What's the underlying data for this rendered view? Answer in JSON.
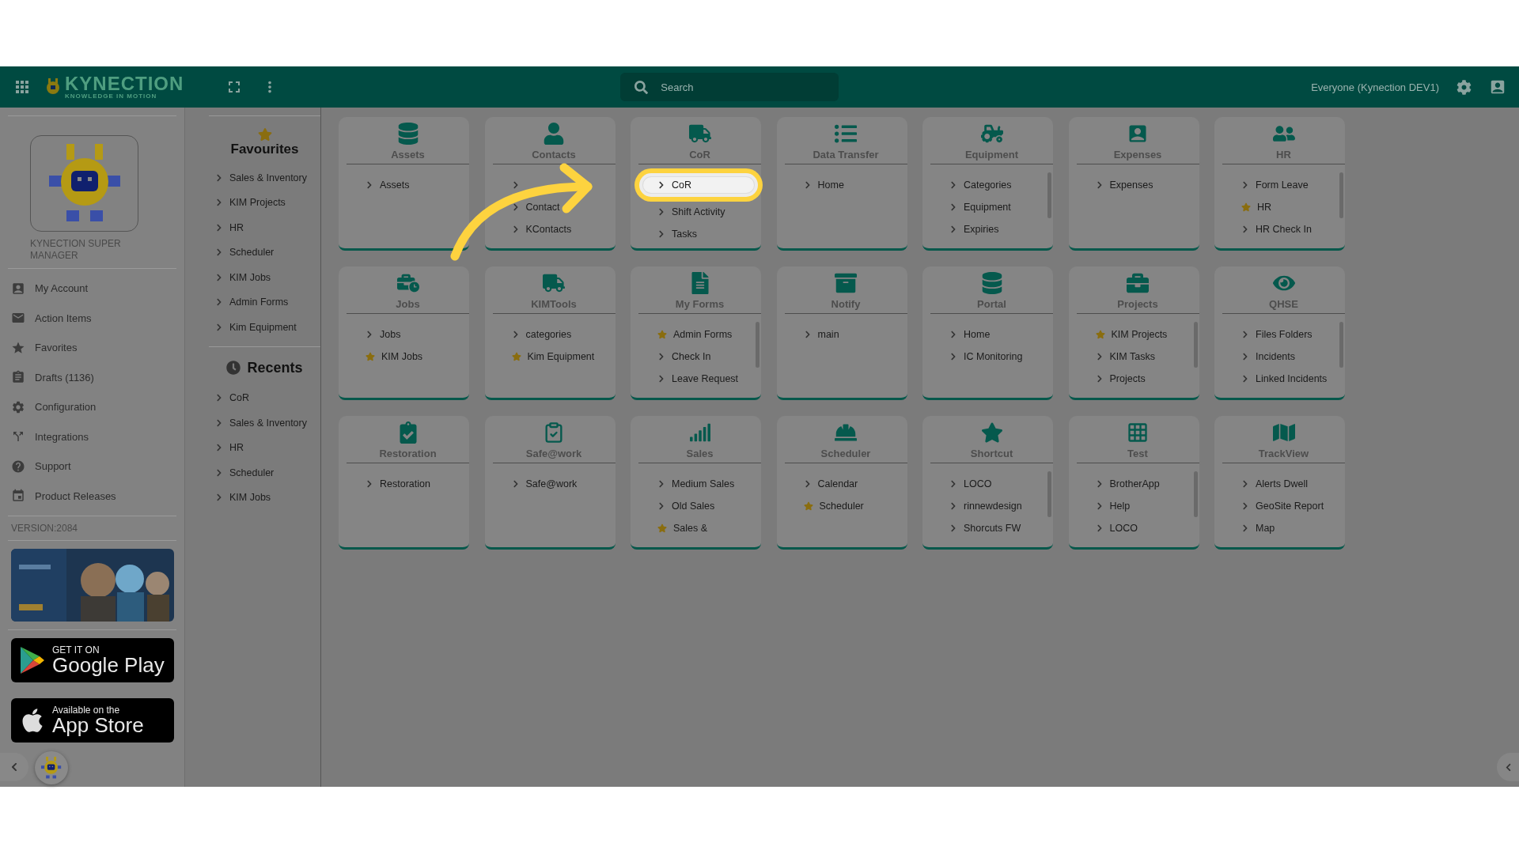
{
  "header": {
    "logo": {
      "name": "KYNECTION",
      "tagline": "KNOWLEDGE IN MOTION"
    },
    "search": {
      "placeholder": "Search"
    },
    "workspace": "Everyone (Kynection DEV1)"
  },
  "profile": {
    "name": "KYNECTION SUPER MANAGER"
  },
  "menu": [
    {
      "label": "My Account"
    },
    {
      "label": "Action Items"
    },
    {
      "label": "Favorites"
    },
    {
      "label": "Drafts (1136)"
    },
    {
      "label": "Configuration"
    },
    {
      "label": "Integrations"
    },
    {
      "label": "Support"
    },
    {
      "label": "Product Releases"
    }
  ],
  "version": "VERSION:2084",
  "store_badges": [
    {
      "top": "GET IT ON",
      "bottom": "Google Play"
    },
    {
      "top": "Available on the",
      "bottom": "App Store"
    }
  ],
  "favourites": {
    "title": "Favourites",
    "items": [
      "Sales & Inventory",
      "KIM Projects",
      "HR",
      "Scheduler",
      "KIM Jobs",
      "Admin Forms",
      "Kim Equipment"
    ]
  },
  "recents": {
    "title": "Recents",
    "items": [
      "CoR",
      "Sales & Inventory",
      "HR",
      "Scheduler",
      "KIM Jobs"
    ]
  },
  "tiles": [
    {
      "title": "Assets",
      "scrollable": false,
      "items": [
        {
          "label": "Assets",
          "starred": false
        }
      ]
    },
    {
      "title": "Contacts",
      "scrollable": false,
      "items": [
        {
          "starred": false
        },
        {
          "label": "Contact",
          "starred": false
        },
        {
          "label": "KContacts",
          "starred": false
        }
      ]
    },
    {
      "title": "CoR",
      "scrollable": false,
      "items": [
        {
          "label": "CoR",
          "starred": false,
          "highlighted": true
        },
        {
          "label": "Shift Activity",
          "starred": false
        },
        {
          "label": "Tasks",
          "starred": false
        }
      ]
    },
    {
      "title": "Data Transfer",
      "scrollable": false,
      "items": [
        {
          "label": "Home",
          "starred": false
        }
      ]
    },
    {
      "title": "Equipment",
      "scrollable": true,
      "items": [
        {
          "label": "Categories",
          "starred": false
        },
        {
          "label": "Equipment",
          "starred": false
        },
        {
          "label": "Expiries",
          "starred": false
        }
      ]
    },
    {
      "title": "Expenses",
      "scrollable": false,
      "items": [
        {
          "label": "Expenses",
          "starred": false
        }
      ]
    },
    {
      "title": "HR",
      "scrollable": true,
      "items": [
        {
          "label": "Form Leave",
          "starred": false
        },
        {
          "label": "HR",
          "starred": true
        },
        {
          "label": "HR Check In",
          "starred": false
        }
      ]
    },
    {
      "title": "Jobs",
      "scrollable": false,
      "items": [
        {
          "label": "Jobs",
          "starred": false
        },
        {
          "label": "KIM Jobs",
          "starred": true
        }
      ]
    },
    {
      "title": "KIMTools",
      "scrollable": false,
      "items": [
        {
          "label": "categories",
          "starred": false
        },
        {
          "label": "Kim Equipment",
          "starred": true
        }
      ]
    },
    {
      "title": "My Forms",
      "scrollable": true,
      "items": [
        {
          "label": "Admin Forms",
          "starred": true
        },
        {
          "label": "Check In",
          "starred": false
        },
        {
          "label": "Leave Request",
          "starred": false
        }
      ]
    },
    {
      "title": "Notify",
      "scrollable": false,
      "items": [
        {
          "label": "main",
          "starred": false
        }
      ]
    },
    {
      "title": "Portal",
      "scrollable": false,
      "items": [
        {
          "label": "Home",
          "starred": false
        },
        {
          "label": "IC Monitoring",
          "starred": false
        }
      ]
    },
    {
      "title": "Projects",
      "scrollable": true,
      "items": [
        {
          "label": "KIM Projects",
          "starred": true
        },
        {
          "label": "KIM Tasks",
          "starred": false
        },
        {
          "label": "Projects",
          "starred": false
        }
      ]
    },
    {
      "title": "QHSE",
      "scrollable": true,
      "items": [
        {
          "label": "Files Folders",
          "starred": false
        },
        {
          "label": "Incidents",
          "starred": false
        },
        {
          "label": "Linked Incidents",
          "starred": false
        }
      ]
    },
    {
      "title": "Restoration",
      "scrollable": false,
      "items": [
        {
          "label": "Restoration",
          "starred": false
        }
      ]
    },
    {
      "title": "Safe@work",
      "scrollable": false,
      "items": [
        {
          "label": "Safe@work",
          "starred": false
        }
      ]
    },
    {
      "title": "Sales",
      "scrollable": false,
      "items": [
        {
          "label": "Medium Sales",
          "starred": false
        },
        {
          "label": "Old Sales",
          "starred": false
        },
        {
          "label": "Sales &",
          "starred": true
        }
      ]
    },
    {
      "title": "Scheduler",
      "scrollable": false,
      "items": [
        {
          "label": "Calendar",
          "starred": false
        },
        {
          "label": "Scheduler",
          "starred": true
        }
      ]
    },
    {
      "title": "Shortcut",
      "scrollable": true,
      "items": [
        {
          "label": "LOCO",
          "starred": false
        },
        {
          "label": "rinnewdesign",
          "starred": false
        },
        {
          "label": "Shorcuts FW",
          "starred": false
        }
      ]
    },
    {
      "title": "Test",
      "scrollable": true,
      "items": [
        {
          "label": "BrotherApp",
          "starred": false
        },
        {
          "label": "Help",
          "starred": false
        },
        {
          "label": "LOCO",
          "starred": false
        }
      ]
    },
    {
      "title": "TrackView",
      "scrollable": false,
      "items": [
        {
          "label": "Alerts Dwell",
          "starred": false
        },
        {
          "label": "GeoSite Report",
          "starred": false
        },
        {
          "label": "Map",
          "starred": false
        }
      ]
    }
  ]
}
